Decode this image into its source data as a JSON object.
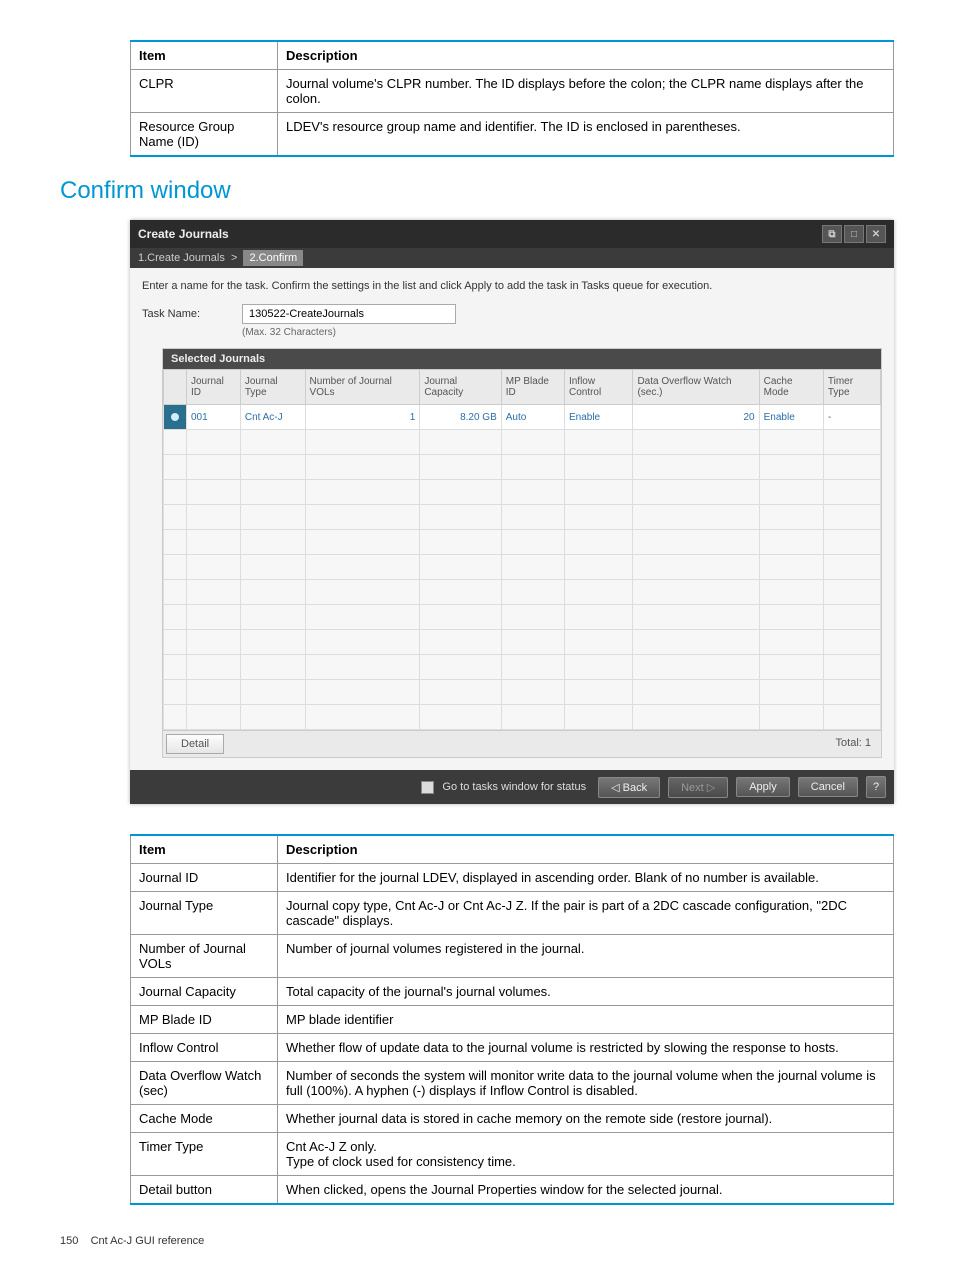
{
  "topTable": {
    "headers": [
      "Item",
      "Description"
    ],
    "rows": [
      {
        "item": "CLPR",
        "desc": "Journal volume's CLPR number. The ID displays before the colon; the CLPR name displays after the colon."
      },
      {
        "item": "Resource Group Name (ID)",
        "desc": "LDEV's resource group name and identifier. The ID is enclosed in parentheses."
      }
    ]
  },
  "sectionHeading": "Confirm window",
  "dialog": {
    "title": "Create Journals",
    "breadcrumb": {
      "step1": "1.Create Journals",
      "step2": "2.Confirm"
    },
    "instruction": "Enter a name for the task. Confirm the settings in the list and click Apply to add the task in Tasks queue for execution.",
    "taskName": {
      "label": "Task Name:",
      "value": "130522-CreateJournals",
      "hint": "(Max. 32 Characters)"
    },
    "panelTitle": "Selected Journals",
    "columns": [
      "Journal ID",
      "Journal Type",
      "Number of Journal VOLs",
      "Journal Capacity",
      "MP Blade ID",
      "Inflow Control",
      "Data Overflow Watch (sec.)",
      "Cache Mode",
      "Timer Type"
    ],
    "row": {
      "journalId": "001",
      "journalType": "Cnt Ac-J",
      "numVols": "1",
      "capacity": "8.20 GB",
      "mpBlade": "Auto",
      "inflow": "Enable",
      "overflow": "20",
      "cache": "Enable",
      "timer": "-"
    },
    "detailLabel": "Detail",
    "totalLabel": "Total: 1",
    "footer": {
      "checkboxLabel": "Go to tasks window for status",
      "back": "◁ Back",
      "next": "Next ▷",
      "apply": "Apply",
      "cancel": "Cancel"
    }
  },
  "bottomTable": {
    "headers": [
      "Item",
      "Description"
    ],
    "rows": [
      {
        "item": "Journal ID",
        "desc": "Identifier for the journal LDEV, displayed in ascending order. Blank of no number is available."
      },
      {
        "item": "Journal Type",
        "desc": "Journal copy type, Cnt Ac-J or Cnt Ac-J Z. If the pair is part of a 2DC cascade configuration, \"2DC cascade\" displays."
      },
      {
        "item": "Number of Journal VOLs",
        "desc": "Number of journal volumes registered in the journal."
      },
      {
        "item": "Journal Capacity",
        "desc": "Total capacity of the journal's journal volumes."
      },
      {
        "item": "MP Blade ID",
        "desc": "MP blade identifier"
      },
      {
        "item": "Inflow Control",
        "desc": "Whether flow of update data to the journal volume is restricted by slowing the response to hosts."
      },
      {
        "item": "Data Overflow Watch (sec)",
        "desc": "Number of seconds the system will monitor write data to the journal volume when the journal volume is full (100%). A hyphen (-) displays if Inflow Control is disabled."
      },
      {
        "item": "Cache Mode",
        "desc": "Whether journal data is stored in cache memory on the remote side (restore journal)."
      },
      {
        "item": "Timer Type",
        "desc": "Cnt Ac-J Z only.\nType of clock used for consistency time."
      },
      {
        "item": "Detail button",
        "desc": "When clicked, opens the Journal Properties window for the selected journal."
      }
    ]
  },
  "pageFooter": {
    "pageNum": "150",
    "section": "Cnt Ac-J GUI reference"
  }
}
